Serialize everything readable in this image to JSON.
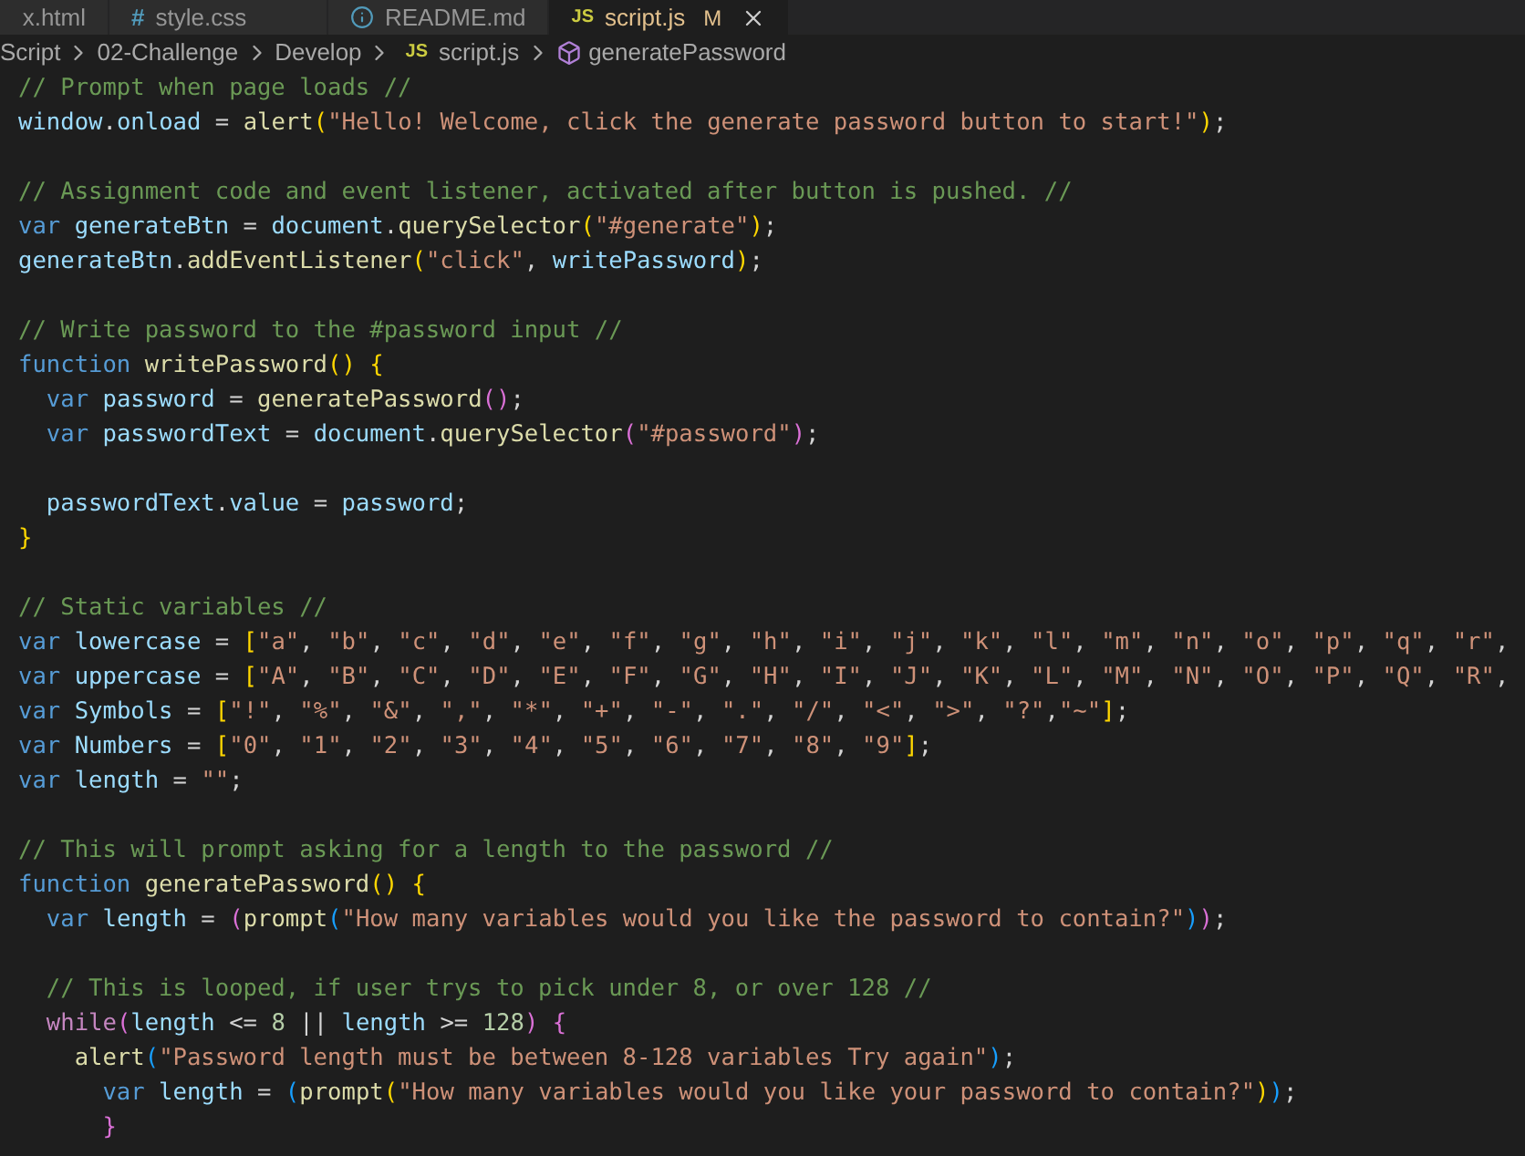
{
  "tabs": [
    {
      "label": "x.html",
      "kind": "html",
      "selected": false
    },
    {
      "label": "style.css",
      "kind": "css",
      "icon_text": "#",
      "selected": false
    },
    {
      "label": "README.md",
      "kind": "markdown",
      "selected": false
    },
    {
      "label": "script.js",
      "kind": "js",
      "icon_text": "JS",
      "badge": "M",
      "selected": true
    }
  ],
  "breadcrumb": [
    {
      "label": "Script",
      "kind": "folder"
    },
    {
      "label": "02-Challenge",
      "kind": "folder"
    },
    {
      "label": "Develop",
      "kind": "folder"
    },
    {
      "label": "script.js",
      "kind": "file",
      "icon_text": "JS"
    },
    {
      "label": "generatePassword",
      "kind": "symbol"
    }
  ],
  "code_lines": [
    {
      "kind": "code",
      "tokens": [
        {
          "kind": "comment",
          "text": "// Prompt when page loads //"
        }
      ]
    },
    {
      "kind": "code",
      "tokens": [
        {
          "kind": "variable",
          "text": "window"
        },
        {
          "kind": "plain",
          "text": "."
        },
        {
          "kind": "variable",
          "text": "onload"
        },
        {
          "kind": "plain",
          "text": " = "
        },
        {
          "kind": "function",
          "text": "alert"
        },
        {
          "kind": "bracket1",
          "text": "("
        },
        {
          "kind": "string",
          "text": "\"Hello! Welcome, click the generate password button to start!\""
        },
        {
          "kind": "bracket1",
          "text": ")"
        },
        {
          "kind": "plain",
          "text": ";"
        }
      ]
    },
    {
      "kind": "blank"
    },
    {
      "kind": "code",
      "tokens": [
        {
          "kind": "comment",
          "text": "// Assignment code and event listener, activated after button is pushed. //"
        }
      ]
    },
    {
      "kind": "code",
      "tokens": [
        {
          "kind": "keyword",
          "text": "var "
        },
        {
          "kind": "variable",
          "text": "generateBtn"
        },
        {
          "kind": "plain",
          "text": " = "
        },
        {
          "kind": "variable",
          "text": "document"
        },
        {
          "kind": "plain",
          "text": "."
        },
        {
          "kind": "function",
          "text": "querySelector"
        },
        {
          "kind": "bracket1",
          "text": "("
        },
        {
          "kind": "string",
          "text": "\"#generate\""
        },
        {
          "kind": "bracket1",
          "text": ")"
        },
        {
          "kind": "plain",
          "text": ";"
        }
      ]
    },
    {
      "kind": "code",
      "tokens": [
        {
          "kind": "variable",
          "text": "generateBtn"
        },
        {
          "kind": "plain",
          "text": "."
        },
        {
          "kind": "function",
          "text": "addEventListener"
        },
        {
          "kind": "bracket1",
          "text": "("
        },
        {
          "kind": "string",
          "text": "\"click\""
        },
        {
          "kind": "plain",
          "text": ", "
        },
        {
          "kind": "variable",
          "text": "writePassword"
        },
        {
          "kind": "bracket1",
          "text": ")"
        },
        {
          "kind": "plain",
          "text": ";"
        }
      ]
    },
    {
      "kind": "blank"
    },
    {
      "kind": "code",
      "tokens": [
        {
          "kind": "comment",
          "text": "// Write password to the #password input //"
        }
      ]
    },
    {
      "kind": "code",
      "tokens": [
        {
          "kind": "keyword",
          "text": "function "
        },
        {
          "kind": "function",
          "text": "writePassword"
        },
        {
          "kind": "bracket1",
          "text": "() {"
        }
      ]
    },
    {
      "kind": "code",
      "tokens": [
        {
          "kind": "keyword",
          "text": "  var "
        },
        {
          "kind": "variable",
          "text": "password"
        },
        {
          "kind": "plain",
          "text": " = "
        },
        {
          "kind": "function",
          "text": "generatePassword"
        },
        {
          "kind": "bracket2",
          "text": "()"
        },
        {
          "kind": "plain",
          "text": ";"
        }
      ]
    },
    {
      "kind": "code",
      "tokens": [
        {
          "kind": "keyword",
          "text": "  var "
        },
        {
          "kind": "variable",
          "text": "passwordText"
        },
        {
          "kind": "plain",
          "text": " = "
        },
        {
          "kind": "variable",
          "text": "document"
        },
        {
          "kind": "plain",
          "text": "."
        },
        {
          "kind": "function",
          "text": "querySelector"
        },
        {
          "kind": "bracket2",
          "text": "("
        },
        {
          "kind": "string",
          "text": "\"#password\""
        },
        {
          "kind": "bracket2",
          "text": ")"
        },
        {
          "kind": "plain",
          "text": ";"
        }
      ]
    },
    {
      "kind": "blank"
    },
    {
      "kind": "code",
      "tokens": [
        {
          "kind": "variable",
          "text": "  passwordText"
        },
        {
          "kind": "plain",
          "text": "."
        },
        {
          "kind": "variable",
          "text": "value"
        },
        {
          "kind": "plain",
          "text": " = "
        },
        {
          "kind": "variable",
          "text": "password"
        },
        {
          "kind": "plain",
          "text": ";"
        }
      ]
    },
    {
      "kind": "code",
      "tokens": [
        {
          "kind": "bracket1",
          "text": "}"
        }
      ]
    },
    {
      "kind": "blank"
    },
    {
      "kind": "code",
      "tokens": [
        {
          "kind": "comment",
          "text": "// Static variables //"
        }
      ]
    },
    {
      "kind": "code",
      "tokens": [
        {
          "kind": "keyword",
          "text": "var "
        },
        {
          "kind": "variable",
          "text": "lowercase"
        },
        {
          "kind": "plain",
          "text": " = "
        },
        {
          "kind": "bracket1",
          "text": "["
        },
        {
          "kind": "string",
          "text": "\"a\""
        },
        {
          "kind": "plain",
          "text": ", "
        },
        {
          "kind": "string",
          "text": "\"b\""
        },
        {
          "kind": "plain",
          "text": ", "
        },
        {
          "kind": "string",
          "text": "\"c\""
        },
        {
          "kind": "plain",
          "text": ", "
        },
        {
          "kind": "string",
          "text": "\"d\""
        },
        {
          "kind": "plain",
          "text": ", "
        },
        {
          "kind": "string",
          "text": "\"e\""
        },
        {
          "kind": "plain",
          "text": ", "
        },
        {
          "kind": "string",
          "text": "\"f\""
        },
        {
          "kind": "plain",
          "text": ", "
        },
        {
          "kind": "string",
          "text": "\"g\""
        },
        {
          "kind": "plain",
          "text": ", "
        },
        {
          "kind": "string",
          "text": "\"h\""
        },
        {
          "kind": "plain",
          "text": ", "
        },
        {
          "kind": "string",
          "text": "\"i\""
        },
        {
          "kind": "plain",
          "text": ", "
        },
        {
          "kind": "string",
          "text": "\"j\""
        },
        {
          "kind": "plain",
          "text": ", "
        },
        {
          "kind": "string",
          "text": "\"k\""
        },
        {
          "kind": "plain",
          "text": ", "
        },
        {
          "kind": "string",
          "text": "\"l\""
        },
        {
          "kind": "plain",
          "text": ", "
        },
        {
          "kind": "string",
          "text": "\"m\""
        },
        {
          "kind": "plain",
          "text": ", "
        },
        {
          "kind": "string",
          "text": "\"n\""
        },
        {
          "kind": "plain",
          "text": ", "
        },
        {
          "kind": "string",
          "text": "\"o\""
        },
        {
          "kind": "plain",
          "text": ", "
        },
        {
          "kind": "string",
          "text": "\"p\""
        },
        {
          "kind": "plain",
          "text": ", "
        },
        {
          "kind": "string",
          "text": "\"q\""
        },
        {
          "kind": "plain",
          "text": ", "
        },
        {
          "kind": "string",
          "text": "\"r\""
        },
        {
          "kind": "plain",
          "text": ","
        }
      ]
    },
    {
      "kind": "code",
      "tokens": [
        {
          "kind": "keyword",
          "text": "var "
        },
        {
          "kind": "variable",
          "text": "uppercase"
        },
        {
          "kind": "plain",
          "text": " = "
        },
        {
          "kind": "bracket1",
          "text": "["
        },
        {
          "kind": "string",
          "text": "\"A\""
        },
        {
          "kind": "plain",
          "text": ", "
        },
        {
          "kind": "string",
          "text": "\"B\""
        },
        {
          "kind": "plain",
          "text": ", "
        },
        {
          "kind": "string",
          "text": "\"C\""
        },
        {
          "kind": "plain",
          "text": ", "
        },
        {
          "kind": "string",
          "text": "\"D\""
        },
        {
          "kind": "plain",
          "text": ", "
        },
        {
          "kind": "string",
          "text": "\"E\""
        },
        {
          "kind": "plain",
          "text": ", "
        },
        {
          "kind": "string",
          "text": "\"F\""
        },
        {
          "kind": "plain",
          "text": ", "
        },
        {
          "kind": "string",
          "text": "\"G\""
        },
        {
          "kind": "plain",
          "text": ", "
        },
        {
          "kind": "string",
          "text": "\"H\""
        },
        {
          "kind": "plain",
          "text": ", "
        },
        {
          "kind": "string",
          "text": "\"I\""
        },
        {
          "kind": "plain",
          "text": ", "
        },
        {
          "kind": "string",
          "text": "\"J\""
        },
        {
          "kind": "plain",
          "text": ", "
        },
        {
          "kind": "string",
          "text": "\"K\""
        },
        {
          "kind": "plain",
          "text": ", "
        },
        {
          "kind": "string",
          "text": "\"L\""
        },
        {
          "kind": "plain",
          "text": ", "
        },
        {
          "kind": "string",
          "text": "\"M\""
        },
        {
          "kind": "plain",
          "text": ", "
        },
        {
          "kind": "string",
          "text": "\"N\""
        },
        {
          "kind": "plain",
          "text": ", "
        },
        {
          "kind": "string",
          "text": "\"O\""
        },
        {
          "kind": "plain",
          "text": ", "
        },
        {
          "kind": "string",
          "text": "\"P\""
        },
        {
          "kind": "plain",
          "text": ", "
        },
        {
          "kind": "string",
          "text": "\"Q\""
        },
        {
          "kind": "plain",
          "text": ", "
        },
        {
          "kind": "string",
          "text": "\"R\""
        },
        {
          "kind": "plain",
          "text": ","
        }
      ]
    },
    {
      "kind": "code",
      "tokens": [
        {
          "kind": "keyword",
          "text": "var "
        },
        {
          "kind": "variable",
          "text": "Symbols"
        },
        {
          "kind": "plain",
          "text": " = "
        },
        {
          "kind": "bracket1",
          "text": "["
        },
        {
          "kind": "string",
          "text": "\"!\""
        },
        {
          "kind": "plain",
          "text": ", "
        },
        {
          "kind": "string",
          "text": "\"%\""
        },
        {
          "kind": "plain",
          "text": ", "
        },
        {
          "kind": "string",
          "text": "\"&\""
        },
        {
          "kind": "plain",
          "text": ", "
        },
        {
          "kind": "string",
          "text": "\",\""
        },
        {
          "kind": "plain",
          "text": ", "
        },
        {
          "kind": "string",
          "text": "\"*\""
        },
        {
          "kind": "plain",
          "text": ", "
        },
        {
          "kind": "string",
          "text": "\"+\""
        },
        {
          "kind": "plain",
          "text": ", "
        },
        {
          "kind": "string",
          "text": "\"-\""
        },
        {
          "kind": "plain",
          "text": ", "
        },
        {
          "kind": "string",
          "text": "\".\""
        },
        {
          "kind": "plain",
          "text": ", "
        },
        {
          "kind": "string",
          "text": "\"/\""
        },
        {
          "kind": "plain",
          "text": ", "
        },
        {
          "kind": "string",
          "text": "\"<\""
        },
        {
          "kind": "plain",
          "text": ", "
        },
        {
          "kind": "string",
          "text": "\">\""
        },
        {
          "kind": "plain",
          "text": ", "
        },
        {
          "kind": "string",
          "text": "\"?\""
        },
        {
          "kind": "plain",
          "text": ","
        },
        {
          "kind": "string",
          "text": "\"~\""
        },
        {
          "kind": "bracket1",
          "text": "]"
        },
        {
          "kind": "plain",
          "text": ";"
        }
      ]
    },
    {
      "kind": "code",
      "tokens": [
        {
          "kind": "keyword",
          "text": "var "
        },
        {
          "kind": "variable",
          "text": "Numbers"
        },
        {
          "kind": "plain",
          "text": " = "
        },
        {
          "kind": "bracket1",
          "text": "["
        },
        {
          "kind": "string",
          "text": "\"0\""
        },
        {
          "kind": "plain",
          "text": ", "
        },
        {
          "kind": "string",
          "text": "\"1\""
        },
        {
          "kind": "plain",
          "text": ", "
        },
        {
          "kind": "string",
          "text": "\"2\""
        },
        {
          "kind": "plain",
          "text": ", "
        },
        {
          "kind": "string",
          "text": "\"3\""
        },
        {
          "kind": "plain",
          "text": ", "
        },
        {
          "kind": "string",
          "text": "\"4\""
        },
        {
          "kind": "plain",
          "text": ", "
        },
        {
          "kind": "string",
          "text": "\"5\""
        },
        {
          "kind": "plain",
          "text": ", "
        },
        {
          "kind": "string",
          "text": "\"6\""
        },
        {
          "kind": "plain",
          "text": ", "
        },
        {
          "kind": "string",
          "text": "\"7\""
        },
        {
          "kind": "plain",
          "text": ", "
        },
        {
          "kind": "string",
          "text": "\"8\""
        },
        {
          "kind": "plain",
          "text": ", "
        },
        {
          "kind": "string",
          "text": "\"9\""
        },
        {
          "kind": "bracket1",
          "text": "]"
        },
        {
          "kind": "plain",
          "text": ";"
        }
      ]
    },
    {
      "kind": "code",
      "tokens": [
        {
          "kind": "keyword",
          "text": "var "
        },
        {
          "kind": "variable",
          "text": "length"
        },
        {
          "kind": "plain",
          "text": " = "
        },
        {
          "kind": "string",
          "text": "\"\""
        },
        {
          "kind": "plain",
          "text": ";"
        }
      ]
    },
    {
      "kind": "blank"
    },
    {
      "kind": "code",
      "tokens": [
        {
          "kind": "comment",
          "text": "// This will prompt asking for a length to the password //"
        }
      ]
    },
    {
      "kind": "code",
      "tokens": [
        {
          "kind": "keyword",
          "text": "function "
        },
        {
          "kind": "function",
          "text": "generatePassword"
        },
        {
          "kind": "bracket1",
          "text": "() {"
        }
      ]
    },
    {
      "kind": "code",
      "tokens": [
        {
          "kind": "keyword",
          "text": "  var "
        },
        {
          "kind": "variable",
          "text": "length"
        },
        {
          "kind": "plain",
          "text": " = "
        },
        {
          "kind": "bracket2",
          "text": "("
        },
        {
          "kind": "function",
          "text": "prompt"
        },
        {
          "kind": "bracket3",
          "text": "("
        },
        {
          "kind": "string",
          "text": "\"How many variables would you like the password to contain?\""
        },
        {
          "kind": "bracket3",
          "text": ")"
        },
        {
          "kind": "bracket2",
          "text": ")"
        },
        {
          "kind": "plain",
          "text": ";"
        }
      ]
    },
    {
      "kind": "blank"
    },
    {
      "kind": "code",
      "tokens": [
        {
          "kind": "comment",
          "text": "  // This is looped, if user trys to pick under 8, or over 128 //"
        }
      ]
    },
    {
      "kind": "code",
      "tokens": [
        {
          "kind": "control",
          "text": "  while"
        },
        {
          "kind": "bracket2",
          "text": "("
        },
        {
          "kind": "variable",
          "text": "length"
        },
        {
          "kind": "plain",
          "text": " <= "
        },
        {
          "kind": "number",
          "text": "8"
        },
        {
          "kind": "plain",
          "text": " || "
        },
        {
          "kind": "variable",
          "text": "length"
        },
        {
          "kind": "plain",
          "text": " >= "
        },
        {
          "kind": "number",
          "text": "128"
        },
        {
          "kind": "bracket2",
          "text": ") {"
        }
      ]
    },
    {
      "kind": "code",
      "tokens": [
        {
          "kind": "function",
          "text": "    alert"
        },
        {
          "kind": "bracket3",
          "text": "("
        },
        {
          "kind": "string",
          "text": "\"Password length must be between 8-128 variables Try again\""
        },
        {
          "kind": "bracket3",
          "text": ")"
        },
        {
          "kind": "plain",
          "text": ";"
        }
      ]
    },
    {
      "kind": "code",
      "tokens": [
        {
          "kind": "keyword",
          "text": "      var "
        },
        {
          "kind": "variable",
          "text": "length"
        },
        {
          "kind": "plain",
          "text": " = "
        },
        {
          "kind": "bracket3",
          "text": "("
        },
        {
          "kind": "function",
          "text": "prompt"
        },
        {
          "kind": "bracket1",
          "text": "("
        },
        {
          "kind": "string",
          "text": "\"How many variables would you like your password to contain?\""
        },
        {
          "kind": "bracket1",
          "text": ")"
        },
        {
          "kind": "bracket3",
          "text": ")"
        },
        {
          "kind": "plain",
          "text": ";"
        }
      ]
    },
    {
      "kind": "code",
      "tokens": [
        {
          "kind": "bracket2",
          "text": "      }"
        }
      ]
    }
  ]
}
